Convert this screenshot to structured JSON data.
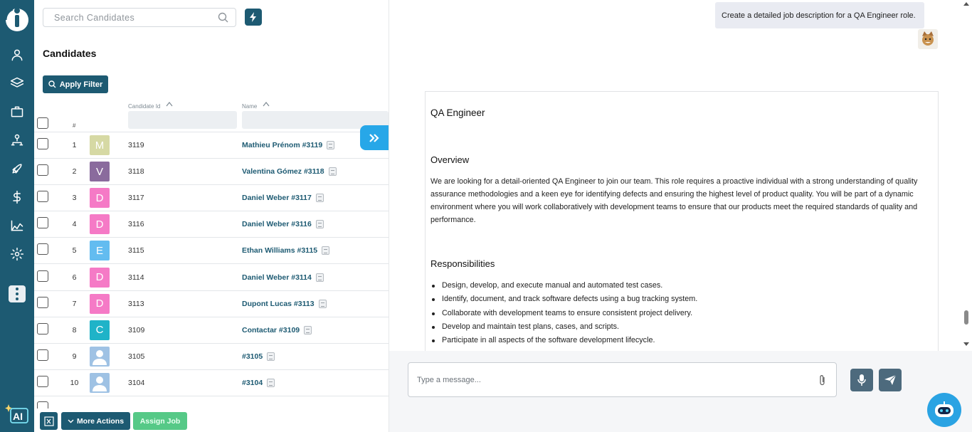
{
  "colors": {
    "primary": "#1d5a72",
    "accent": "#27a7e8",
    "success": "#56c987"
  },
  "search": {
    "placeholder": "Search Candidates"
  },
  "page_title": "Candidates",
  "filter_label": "Apply Filter",
  "table": {
    "columns": {
      "index": "#",
      "candidate_id": "Candidate Id",
      "name": "Name"
    },
    "rows": [
      {
        "num": "1",
        "initial": "M",
        "color": "#d6d9a4",
        "id": "3119",
        "name": "Mathieu Prénom #3119"
      },
      {
        "num": "2",
        "initial": "V",
        "color": "#8a6b9d",
        "id": "3118",
        "name": "Valentina Gómez #3118"
      },
      {
        "num": "3",
        "initial": "D",
        "color": "#f57ac6",
        "id": "3117",
        "name": "Daniel Weber #3117"
      },
      {
        "num": "4",
        "initial": "D",
        "color": "#f57ac6",
        "id": "3116",
        "name": "Daniel Weber #3116"
      },
      {
        "num": "5",
        "initial": "E",
        "color": "#63bcf0",
        "id": "3115",
        "name": "Ethan Williams #3115"
      },
      {
        "num": "6",
        "initial": "D",
        "color": "#f57ac6",
        "id": "3114",
        "name": "Daniel Weber #3114"
      },
      {
        "num": "7",
        "initial": "D",
        "color": "#f57ac6",
        "id": "3113",
        "name": "Dupont Lucas #3113"
      },
      {
        "num": "8",
        "initial": "C",
        "color": "#1fb3c8",
        "id": "3109",
        "name": "Contactar #3109"
      },
      {
        "num": "9",
        "initial": "",
        "color": "#9fc2e4",
        "id": "3105",
        "name": "#3105"
      },
      {
        "num": "10",
        "initial": "",
        "color": "#9fc2e4",
        "id": "3104",
        "name": "#3104"
      }
    ]
  },
  "bottom_bar": {
    "more_actions": "More Actions",
    "assign_job": "Assign Job"
  },
  "chat": {
    "user_message": "Create a detailed job description for a QA Engineer role.",
    "jd_title": "QA Engineer",
    "overview_heading": "Overview",
    "overview_text": "We are looking for a detail-oriented QA Engineer to join our team. This role requires a proactive individual with a strong understanding of quality assurance methodologies and a keen eye for identifying defects and ensuring the highest level of product quality. You will be part of a dynamic environment where you will work collaboratively with development teams to ensure that our products meet the required standards of quality and performance.",
    "responsibilities_heading": "Responsibilities",
    "responsibilities": [
      "Design, develop, and execute manual and automated test cases.",
      "Identify, document, and track software defects using a bug tracking system.",
      "Collaborate with development teams to ensure consistent project delivery.",
      "Develop and maintain test plans, cases, and scripts.",
      "Participate in all aspects of the software development lifecycle."
    ],
    "message_placeholder": "Type a message..."
  }
}
